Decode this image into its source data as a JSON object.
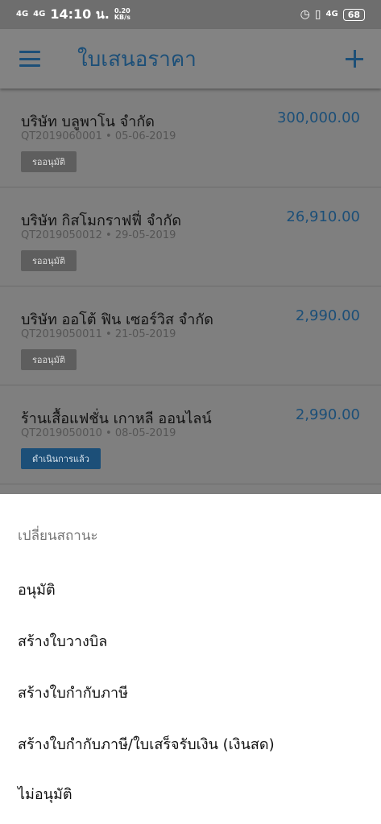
{
  "status_bar": {
    "signal_1": "4G",
    "signal_2": "4G",
    "time": "14:10 น.",
    "speed_value": "0.20",
    "speed_unit": "KB/s",
    "network": "4G",
    "battery": "68"
  },
  "app_bar": {
    "title": "ใบเสนอราคา",
    "menu_icon": "hamburger-menu-icon",
    "add_icon": "plus-icon"
  },
  "quotes": [
    {
      "customer": "บริษัท บลูพาโน จำกัด",
      "number": "QT2019060001",
      "date": "05-06-2019",
      "meta": "QT2019060001 • 05-06-2019",
      "amount": "300,000.00",
      "status": "รออนุมัติ",
      "status_type": "pending"
    },
    {
      "customer": "บริษัท กิสโมกราฟฟี่ จำกัด",
      "number": "QT2019050012",
      "date": "29-05-2019",
      "meta": "QT2019050012 • 29-05-2019",
      "amount": "26,910.00",
      "status": "รออนุมัติ",
      "status_type": "pending"
    },
    {
      "customer": "บริษัท ออโต้ ฟิน เซอร์วิส จำกัด",
      "number": "QT2019050011",
      "date": "21-05-2019",
      "meta": "QT2019050011 • 21-05-2019",
      "amount": "2,990.00",
      "status": "รออนุมัติ",
      "status_type": "pending"
    },
    {
      "customer": "ร้านเสื้อแฟชั่น เกาหลี ออนไลน์",
      "number": "QT2019050010",
      "date": "08-05-2019",
      "meta": "QT2019050010 • 08-05-2019",
      "amount": "2,990.00",
      "status": "ดำเนินการแล้ว",
      "status_type": "done"
    }
  ],
  "sheet": {
    "title": "เปลี่ยนสถานะ",
    "options": [
      "อนุมัติ",
      "สร้างใบวางบิล",
      "สร้างใบกำกับภาษี",
      "สร้างใบกำกับภาษี/ใบเสร็จรับเงิน (เงินสด)",
      "ไม่อนุมัติ"
    ]
  },
  "colors": {
    "accent": "#1c4f78",
    "overlay": "#7f7f7f",
    "badge_pending": "#5e5e5e",
    "badge_done": "#1c4f78"
  }
}
